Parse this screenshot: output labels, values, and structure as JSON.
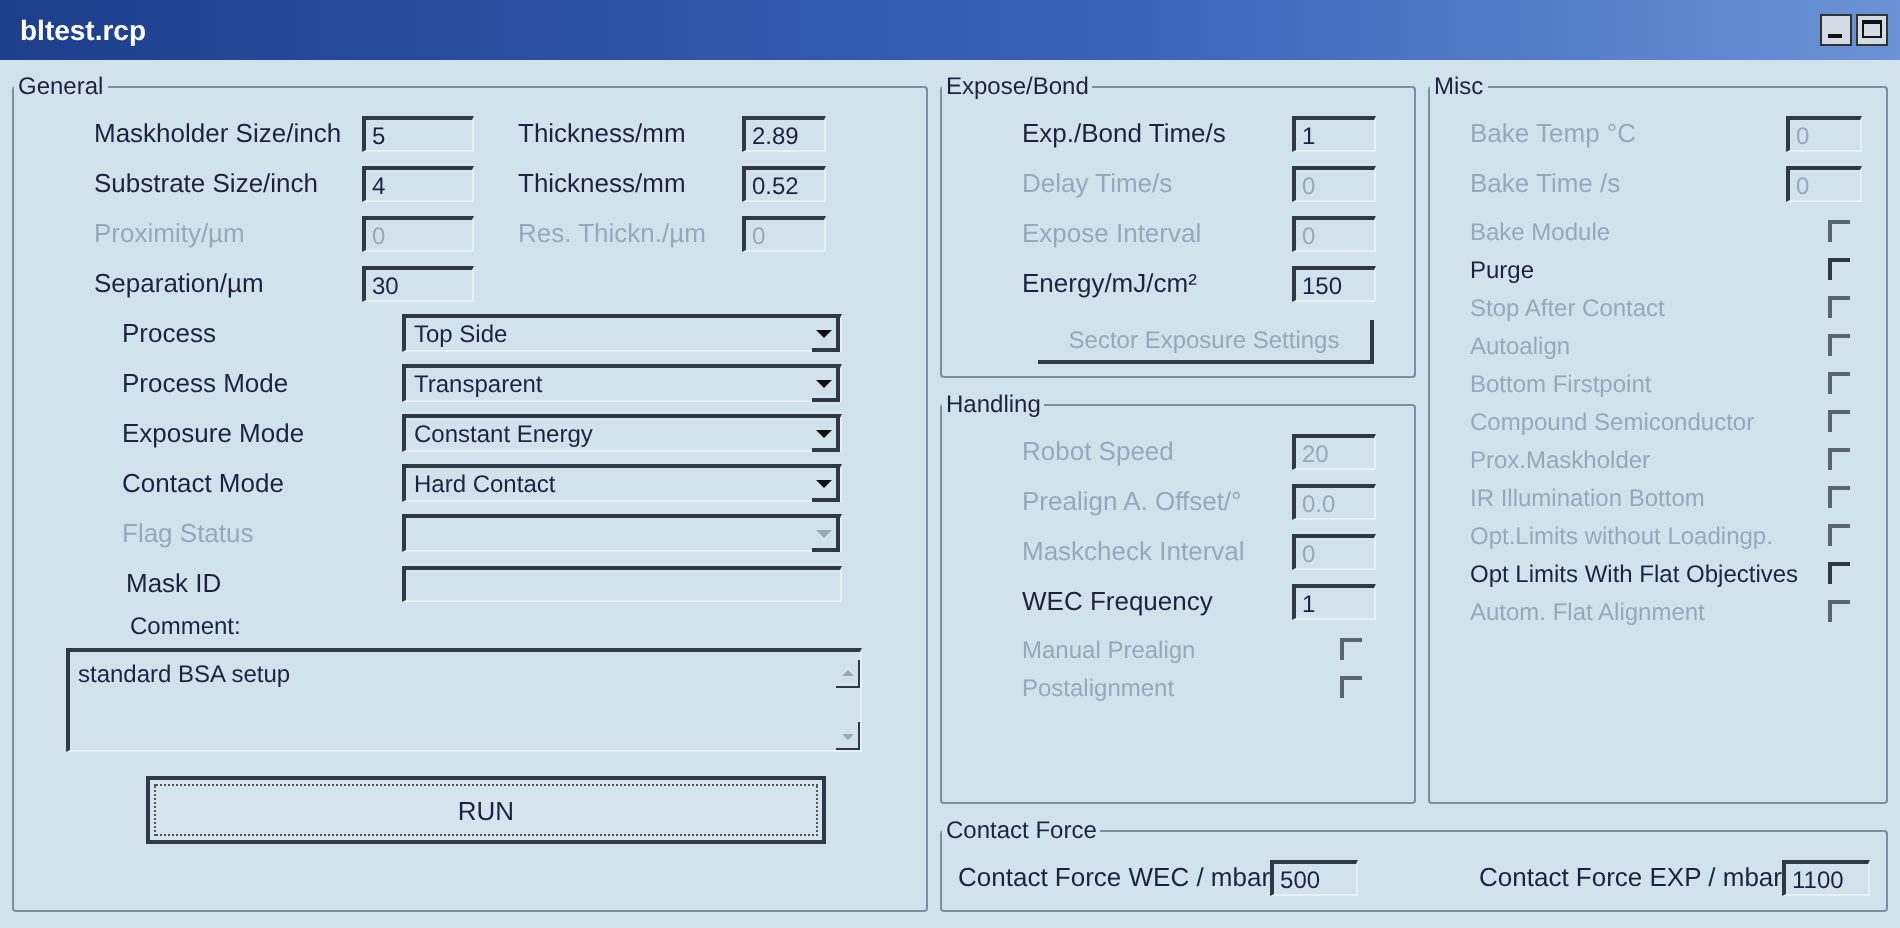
{
  "window": {
    "title": "bltest.rcp"
  },
  "general": {
    "title": "General",
    "rows": [
      {
        "label": "Maskholder Size/inch",
        "value": "5",
        "disabled": false,
        "pair": {
          "label": "Thickness/mm",
          "value": "2.89",
          "disabled": false
        }
      },
      {
        "label": "Substrate Size/inch",
        "value": "4",
        "disabled": false,
        "pair": {
          "label": "Thickness/mm",
          "value": "0.52",
          "disabled": false
        }
      },
      {
        "label": "Proximity/µm",
        "value": "0",
        "disabled": true,
        "pair": {
          "label": "Res. Thickn./µm",
          "value": "0",
          "disabled": true
        }
      },
      {
        "label": "Separation/µm",
        "value": "30",
        "disabled": false
      }
    ],
    "selects": [
      {
        "label": "Process",
        "value": "Top Side",
        "disabled": false
      },
      {
        "label": "Process Mode",
        "value": "Transparent",
        "disabled": false
      },
      {
        "label": "Exposure Mode",
        "value": "Constant Energy",
        "disabled": false
      },
      {
        "label": "Contact Mode",
        "value": "Hard Contact",
        "disabled": false
      },
      {
        "label": "Flag Status",
        "disabled": true
      }
    ],
    "mask_id": {
      "label": "Mask ID"
    },
    "comment": {
      "label": "Comment:",
      "value": "standard BSA setup"
    },
    "run_button": "RUN"
  },
  "expose": {
    "title": "Expose/Bond",
    "fields": [
      {
        "label": "Exp./Bond Time/s",
        "value": "1",
        "disabled": false
      },
      {
        "label": "Delay Time/s",
        "value": "0",
        "disabled": true
      },
      {
        "label": "Expose Interval",
        "value": "0",
        "disabled": true
      },
      {
        "label": "Energy/mJ/cm²",
        "value": "150",
        "disabled": false
      }
    ],
    "sector_button": {
      "label": "Sector Exposure Settings",
      "disabled": true
    }
  },
  "handling": {
    "title": "Handling",
    "fields": [
      {
        "label": "Robot Speed",
        "value": "20",
        "disabled": true
      },
      {
        "label": "Prealign A. Offset/°",
        "value": "0.0",
        "disabled": true
      },
      {
        "label": "Maskcheck Interval",
        "value": "0",
        "disabled": true
      },
      {
        "label": "WEC Frequency",
        "value": "1",
        "disabled": false
      }
    ],
    "checks": [
      {
        "label": "Manual Prealign",
        "checked": false,
        "disabled": true
      },
      {
        "label": "Postalignment",
        "checked": false,
        "disabled": true
      }
    ]
  },
  "misc": {
    "title": "Misc",
    "fields": [
      {
        "label": "Bake Temp °C",
        "value": "0",
        "disabled": true
      },
      {
        "label": "Bake Time /s",
        "value": "0",
        "disabled": true
      }
    ],
    "checks": [
      {
        "label": "Bake Module",
        "checked": false,
        "disabled": true
      },
      {
        "label": "Purge",
        "checked": false,
        "disabled": false
      },
      {
        "label": "Stop After Contact",
        "checked": false,
        "disabled": true
      },
      {
        "label": "Autoalign",
        "checked": false,
        "disabled": true
      },
      {
        "label": "Bottom Firstpoint",
        "checked": false,
        "disabled": true
      },
      {
        "label": "Compound Semiconductor",
        "checked": false,
        "disabled": true
      },
      {
        "label": "Prox.Maskholder",
        "checked": false,
        "disabled": true
      },
      {
        "label": "IR Illumination Bottom",
        "checked": false,
        "disabled": true
      },
      {
        "label": "Opt.Limits without Loadingp.",
        "checked": false,
        "disabled": true
      },
      {
        "label": "Opt Limits With Flat Objectives",
        "checked": false,
        "disabled": false
      },
      {
        "label": "Autom. Flat Alignment",
        "checked": false,
        "disabled": true
      }
    ]
  },
  "contact_force": {
    "title": "Contact Force",
    "fields": [
      {
        "label": "Contact Force WEC / mbar",
        "value": "500",
        "disabled": false
      },
      {
        "label": "Contact Force EXP / mbar",
        "value": "1100",
        "disabled": false
      }
    ]
  }
}
